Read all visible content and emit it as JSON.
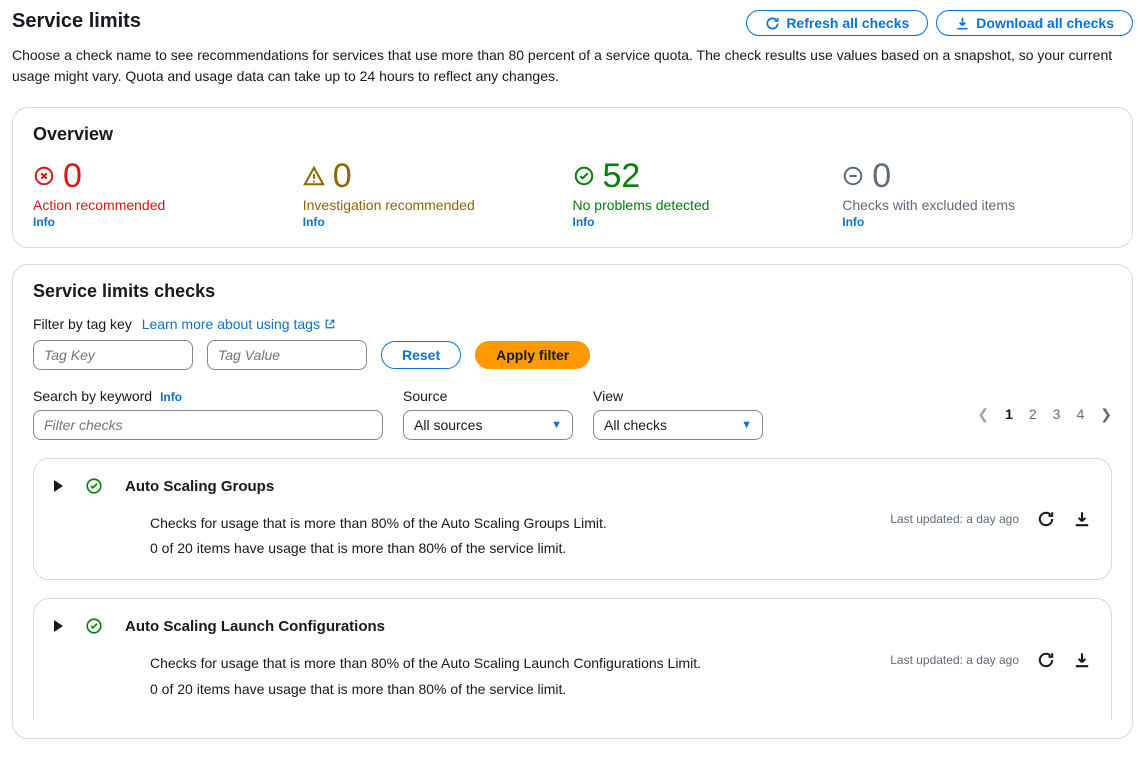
{
  "header": {
    "title": "Service limits",
    "refresh_btn": "Refresh all checks",
    "download_btn": "Download all checks"
  },
  "description": "Choose a check name to see recommendations for services that use more than 80 percent of a service quota. The check results use values based on a snapshot, so your current usage might vary. Quota and usage data can take up to 24 hours to reflect any changes.",
  "overview": {
    "title": "Overview",
    "items": [
      {
        "count": "0",
        "label": "Action recommended",
        "info": "Info",
        "color": "red",
        "icon": "error"
      },
      {
        "count": "0",
        "label": "Investigation recommended",
        "info": "Info",
        "color": "amber",
        "icon": "warn"
      },
      {
        "count": "52",
        "label": "No problems detected",
        "info": "Info",
        "color": "green",
        "icon": "ok"
      },
      {
        "count": "0",
        "label": "Checks with excluded items",
        "info": "Info",
        "color": "grey",
        "icon": "minus"
      }
    ]
  },
  "checks_panel": {
    "title": "Service limits checks",
    "filter_tag_label": "Filter by tag key",
    "learn_link": "Learn more about using tags",
    "tag_key_placeholder": "Tag Key",
    "tag_value_placeholder": "Tag Value",
    "reset_btn": "Reset",
    "apply_btn": "Apply filter",
    "search_label": "Search by keyword",
    "search_info": "Info",
    "filter_placeholder": "Filter checks",
    "source_label": "Source",
    "source_value": "All sources",
    "view_label": "View",
    "view_value": "All checks",
    "pager": {
      "pages": [
        "1",
        "2",
        "3",
        "4"
      ],
      "active": "1"
    }
  },
  "checks": [
    {
      "title": "Auto Scaling Groups",
      "line1": "Checks for usage that is more than 80% of the Auto Scaling Groups Limit.",
      "line2": "0 of 20 items have usage that is more than 80% of the service limit.",
      "updated": "Last updated: a day ago"
    },
    {
      "title": "Auto Scaling Launch Configurations",
      "line1": "Checks for usage that is more than 80% of the Auto Scaling Launch Configurations Limit.",
      "line2": "0 of 20 items have usage that is more than 80% of the service limit.",
      "updated": "Last updated: a day ago"
    }
  ]
}
